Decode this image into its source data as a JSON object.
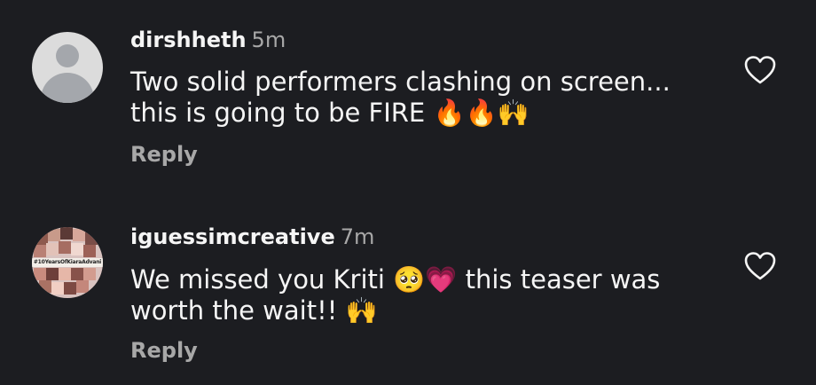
{
  "comments": [
    {
      "username": "dirshheth",
      "time": "5m",
      "text": "Two solid performers clashing on screen... this is going to be FIRE 🔥🔥🙌",
      "reply_label": "Reply",
      "avatar": "default-avatar-icon",
      "like_icon": "heart-outline-icon"
    },
    {
      "username": "iguessimcreative",
      "time": "7m",
      "text": "We missed you Kriti 🥺💗 this teaser was worth the wait!! 🙌",
      "reply_label": "Reply",
      "avatar": "collage-avatar",
      "avatar_banner": "#10YearsOfKiaraAdvani",
      "like_icon": "heart-outline-icon"
    }
  ],
  "colors": {
    "background": "#1c1d21",
    "primary_text": "#f5f5f5",
    "secondary_text": "#a8a8a8",
    "default_avatar_bg": "#dcdcdc",
    "default_avatar_fg": "#a4a7ac"
  }
}
